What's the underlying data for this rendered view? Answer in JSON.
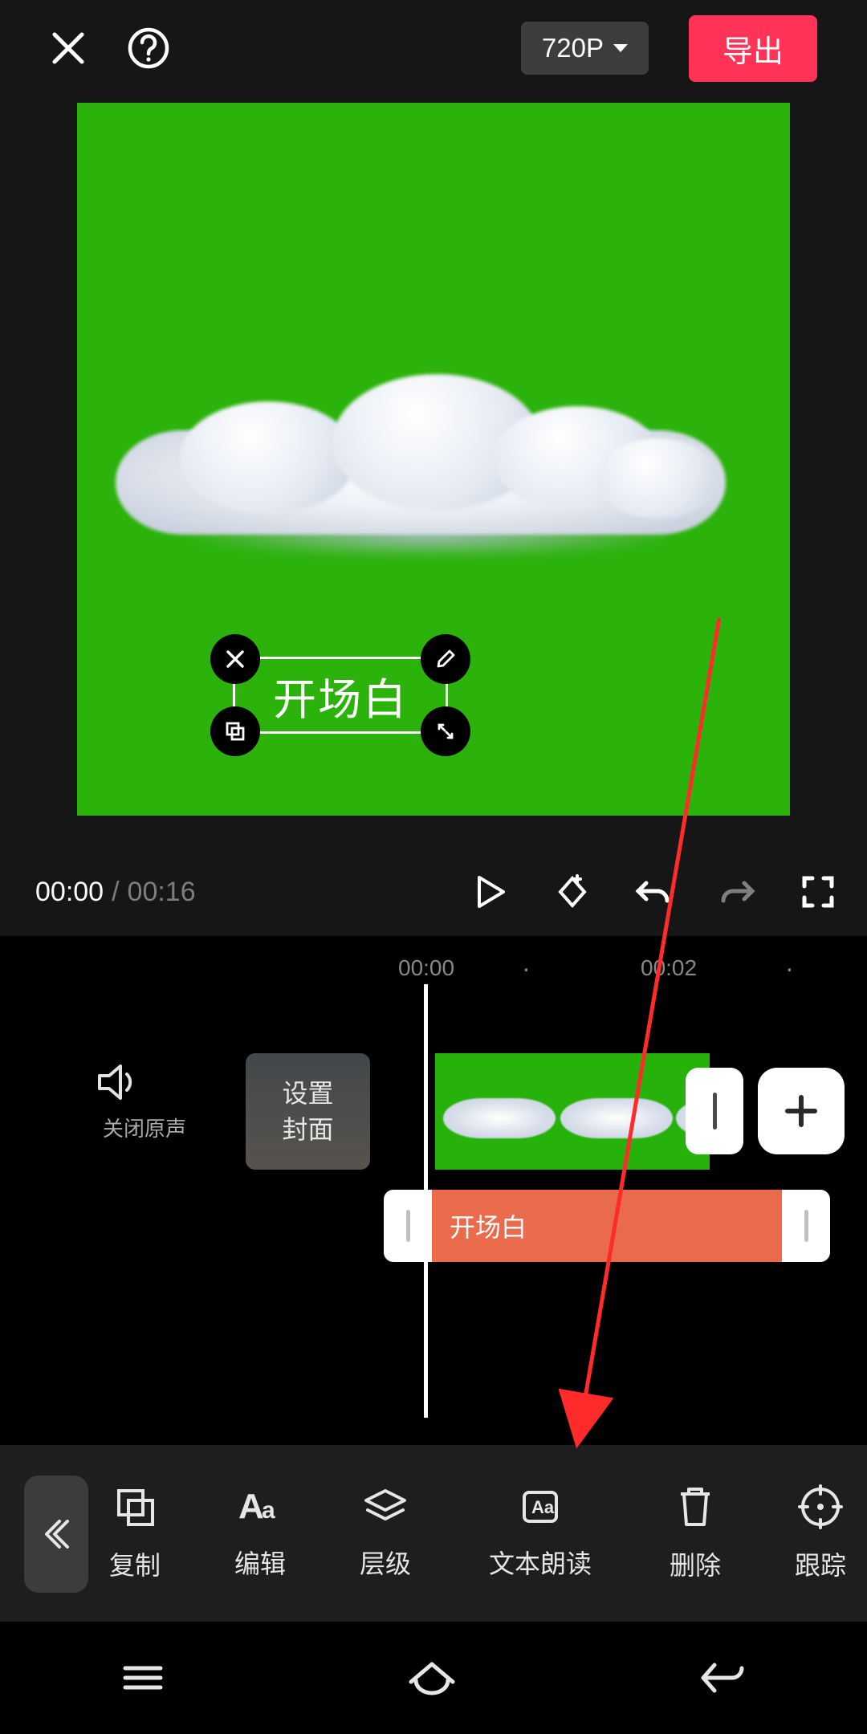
{
  "header": {
    "resolution_label": "720P",
    "export_label": "导出"
  },
  "preview": {
    "text_overlay": "开场白"
  },
  "playback": {
    "current_time": "00:00",
    "separator": "/",
    "total_time": "00:16"
  },
  "ruler": {
    "t0": "00:00",
    "t1": "00:02"
  },
  "timeline": {
    "mute_label": "关闭原声",
    "cover_button": "设置\n封面",
    "text_clip_label": "开场白"
  },
  "toolbar": {
    "items": [
      {
        "id": "copy",
        "label": "复制"
      },
      {
        "id": "edit",
        "label": "编辑"
      },
      {
        "id": "layer",
        "label": "层级"
      },
      {
        "id": "tts",
        "label": "文本朗读"
      },
      {
        "id": "delete",
        "label": "删除"
      },
      {
        "id": "track",
        "label": "跟踪"
      }
    ]
  }
}
